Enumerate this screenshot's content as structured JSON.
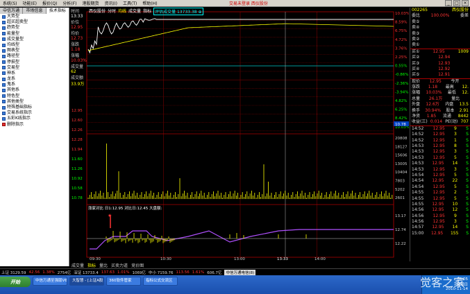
{
  "menu": {
    "items": [
      "系统(S)",
      "功能(E)",
      "报价(Q)",
      "分析(F)",
      "港股期货",
      "资讯(I)",
      "工具(T)",
      "帮助(H)"
    ],
    "title": "交易未登录  西仪股份"
  },
  "left_tabs": [
    "中信万通",
    "市场信息",
    "技术指标"
  ],
  "left_items": [
    {
      "label": "大势型",
      "icon": "folder-icon"
    },
    {
      "label": "超买超卖型",
      "icon": "folder-icon"
    },
    {
      "label": "趋势型",
      "icon": "folder-icon"
    },
    {
      "label": "能量型",
      "icon": "folder-icon"
    },
    {
      "label": "成交量型",
      "icon": "folder-icon"
    },
    {
      "label": "均线型",
      "icon": "folder-icon"
    },
    {
      "label": "图表型",
      "icon": "folder-icon"
    },
    {
      "label": "路径型",
      "icon": "folder-icon"
    },
    {
      "label": "停损型",
      "icon": "folder-icon"
    },
    {
      "label": "交易型",
      "icon": "folder-icon"
    },
    {
      "label": "神系",
      "icon": "folder-icon"
    },
    {
      "label": "龙系",
      "icon": "folder-icon"
    },
    {
      "label": "鬼系",
      "icon": "folder-icon"
    },
    {
      "label": "其他系",
      "icon": "folder-icon"
    },
    {
      "label": "特色型",
      "icon": "folder-icon"
    },
    {
      "label": "其他类型",
      "icon": "folder-icon"
    },
    {
      "label": "特殊基础指标",
      "icon": "folder-icon"
    },
    {
      "label": "交易系统指示",
      "icon": "folder-icon"
    },
    {
      "label": "五彩K线指示",
      "icon": "folder-icon"
    },
    {
      "label": "删除指示",
      "icon": "delete-icon"
    }
  ],
  "left_header": {
    "time_label": "时间",
    "time": "13:33",
    "price_label": "价位",
    "price": "12.95",
    "avg_label": "均价",
    "avg": "12.73",
    "chg_label": "涨跌",
    "chg": "1.18",
    "pct_label": "涨幅",
    "pct": "10.03%",
    "vol_label": "成交量",
    "vol": "62",
    "amt_label": "成交额",
    "amt": "33.9万"
  },
  "chart_header": {
    "stock": "西仪股份",
    "mode": "分时",
    "items": [
      "均线",
      "成交量",
      "指标"
    ],
    "box": "评估成交量 13733.38 ⊕"
  },
  "left_axis": [
    "12.95",
    "12.60",
    "12.26",
    "12.28",
    "11.94",
    "11.60",
    "11.26",
    "10.92",
    "10.58",
    "10.78"
  ],
  "right_axis": [
    "10.03%",
    "8.59%",
    "6.75%",
    "4.72%",
    "3.76%",
    "2.25%",
    "0.55%",
    "-0.86%",
    "-2.36%",
    "-3.94%",
    "4.82%",
    "6.25%",
    "8.42%",
    "10.03%"
  ],
  "vol_axis": [
    "20808",
    "18127",
    "15606",
    "13005",
    "10404",
    "7803",
    "5202",
    "2601"
  ],
  "indicator": {
    "title": "涨家对比  日1:12.95  对比日:12.45  大盘额:",
    "axis": [
      "13.17",
      "12.74",
      "12.22"
    ]
  },
  "time_axis": [
    "09:30",
    "10:30",
    "13:00",
    "13:33",
    "14:00"
  ],
  "cursor_price": "10.78",
  "quote": {
    "code": "002265",
    "name": "西仪股份",
    "weibi_label": "委比",
    "weibi": "100.00%",
    "weicha_label": "委差",
    "weicha": "",
    "sell": [
      {
        "label": "卖⑤",
        "price": "",
        "vol": ""
      },
      {
        "label": "卖④",
        "price": "",
        "vol": ""
      },
      {
        "label": "卖③",
        "price": "",
        "vol": ""
      },
      {
        "label": "卖②",
        "price": "",
        "vol": ""
      },
      {
        "label": "卖①",
        "price": "",
        "vol": ""
      }
    ],
    "buy": [
      {
        "label": "买①",
        "price": "12.95",
        "vol": "1009"
      },
      {
        "label": "买②",
        "price": "12.94",
        "vol": ""
      },
      {
        "label": "买③",
        "price": "12.93",
        "vol": ""
      },
      {
        "label": "买④",
        "price": "12.92",
        "vol": ""
      },
      {
        "label": "买⑤",
        "price": "12.91",
        "vol": ""
      }
    ],
    "stats": [
      {
        "a": "现价",
        "b": "12.95",
        "c": "今开",
        "d": ""
      },
      {
        "a": "涨跌",
        "b": "1.18",
        "c": "最高",
        "d": "12."
      },
      {
        "a": "涨幅",
        "b": "10.03%",
        "c": "最低",
        "d": "12."
      },
      {
        "a": "总量",
        "b": "26.1万",
        "c": "量比",
        "d": ""
      },
      {
        "a": "外盘",
        "b": "12.6万",
        "c": "内盘",
        "d": "13.5"
      },
      {
        "a": "换手",
        "b": "30.94%",
        "c": "股本",
        "d": "2.91"
      },
      {
        "a": "净资",
        "b": "1.85",
        "c": "流通",
        "d": "8442"
      },
      {
        "a": "收益(三)",
        "b": "0.014",
        "c": "PE(动)",
        "d": "707"
      }
    ],
    "ticks": [
      {
        "t": "14:52",
        "p": "12.95",
        "v": "9",
        "f": "S"
      },
      {
        "t": "14:52",
        "p": "12.95",
        "v": "3",
        "f": "S"
      },
      {
        "t": "14:52",
        "p": "12.95",
        "v": "1",
        "f": "S"
      },
      {
        "t": "14:53",
        "p": "12.95",
        "v": "8",
        "f": "S"
      },
      {
        "t": "14:53",
        "p": "12.95",
        "v": "3",
        "f": "S"
      },
      {
        "t": "14:53",
        "p": "12.95",
        "v": "5",
        "f": "S"
      },
      {
        "t": "14:53",
        "p": "12.95",
        "v": "14",
        "f": "S"
      },
      {
        "t": "14:53",
        "p": "12.95",
        "v": "3",
        "f": "S"
      },
      {
        "t": "14:54",
        "p": "12.95",
        "v": "5",
        "f": "S"
      },
      {
        "t": "14:54",
        "p": "12.95",
        "v": "22",
        "f": "S"
      },
      {
        "t": "14:54",
        "p": "12.95",
        "v": "5",
        "f": "S"
      },
      {
        "t": "14:55",
        "p": "12.95",
        "v": "2",
        "f": "S"
      },
      {
        "t": "14:55",
        "p": "12.95",
        "v": "5",
        "f": "S"
      },
      {
        "t": "14:55",
        "p": "12.95",
        "v": "10",
        "f": "S"
      },
      {
        "t": "14:56",
        "p": "12.95",
        "v": "12",
        "f": "S"
      },
      {
        "t": "14:56",
        "p": "12.95",
        "v": "9",
        "f": "S"
      },
      {
        "t": "14:56",
        "p": "12.95",
        "v": "3",
        "f": "S"
      },
      {
        "t": "14:57",
        "p": "12.95",
        "v": "14",
        "f": "S"
      },
      {
        "t": "15:00",
        "p": "12.95",
        "v": "155",
        "f": "S"
      }
    ]
  },
  "bottom_tabs": [
    "成交量",
    "指标",
    "量比",
    "买卖力道",
    "竞价图"
  ],
  "status": [
    "上证 3129.59",
    "42.56",
    "1.38%",
    "2754亿",
    "深证 13733.4",
    "137.63",
    "1.01%",
    "1069亿",
    "中小 7159.76",
    "113.56",
    "1.61%",
    "606.7亿",
    "中信万通电信(8)"
  ],
  "taskbar": {
    "start": "开始",
    "tasks": [
      "中信万通至强版V6",
      "大智慧 - [上证A股]",
      "360软件管家",
      "指标公式交流区"
    ],
    "time": "16:05",
    "day": "星期日",
    "date": "2010-11-14"
  },
  "watermark": "觉客之家",
  "colors": {
    "up": "#ff3333",
    "down": "#00ff00",
    "price_line": "#ffffff",
    "avg_line": "#ffff00",
    "grid": "#880000"
  }
}
